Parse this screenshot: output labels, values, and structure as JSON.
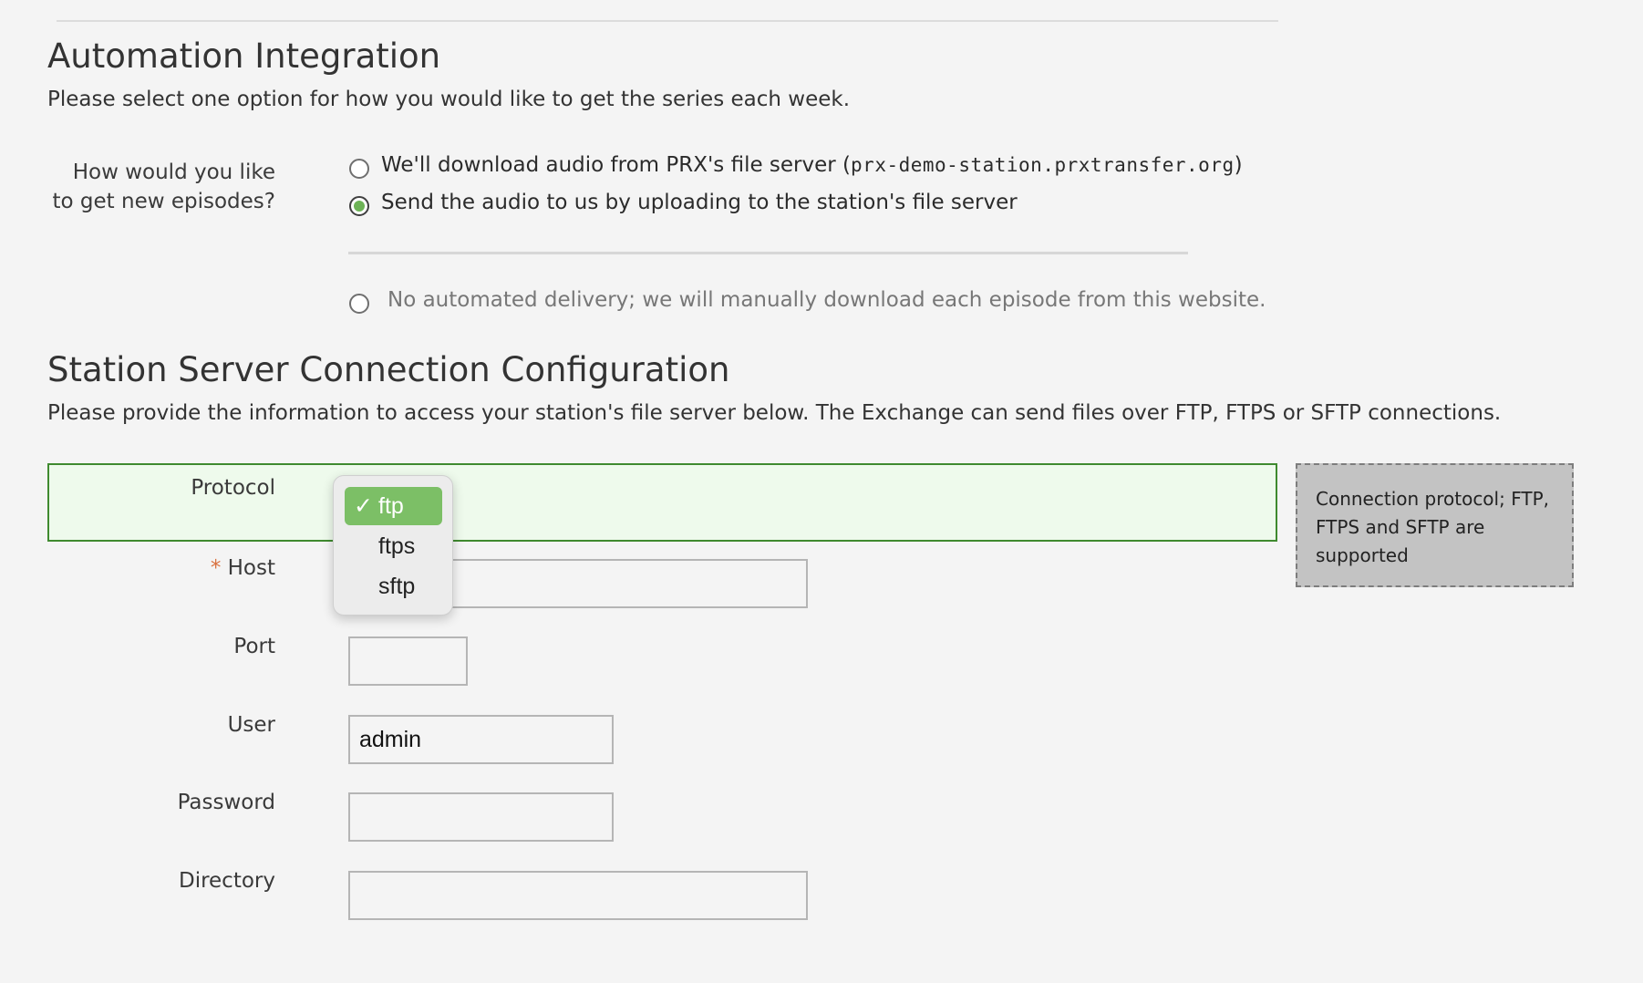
{
  "automation": {
    "title": "Automation Integration",
    "description": "Please select one option for how you would like to get the series each week.",
    "question_line1": "How would you like",
    "question_line2": "to get new episodes?",
    "option1_text": "We'll download audio from PRX's file server (",
    "option1_mono": "prx-demo-station.prxtransfer.org",
    "option1_close": ")",
    "option2_text": "Send the audio to us by uploading to the station's file server",
    "option3_text": "No automated delivery; we will manually download each episode from this website."
  },
  "connection": {
    "title": "Station Server Connection Configuration",
    "description": "Please provide the information to access your station's file server below. The Exchange can send files over FTP, FTPS or SFTP connections.",
    "protocol_label": "Protocol",
    "required_marker": "*",
    "host_label": "Host",
    "port_label": "Port",
    "user_label": "User",
    "user_value": "admin",
    "password_label": "Password",
    "directory_label": "Directory",
    "tooltip": "Connection protocol; FTP, FTPS and SFTP are supported"
  },
  "protocol_menu": {
    "check": "✓",
    "options": [
      "ftp",
      "ftps",
      "sftp"
    ],
    "selected": "ftp"
  },
  "colors": {
    "accent_green": "#6db356",
    "row_border": "#3f8a2f",
    "required": "#d9713f"
  }
}
